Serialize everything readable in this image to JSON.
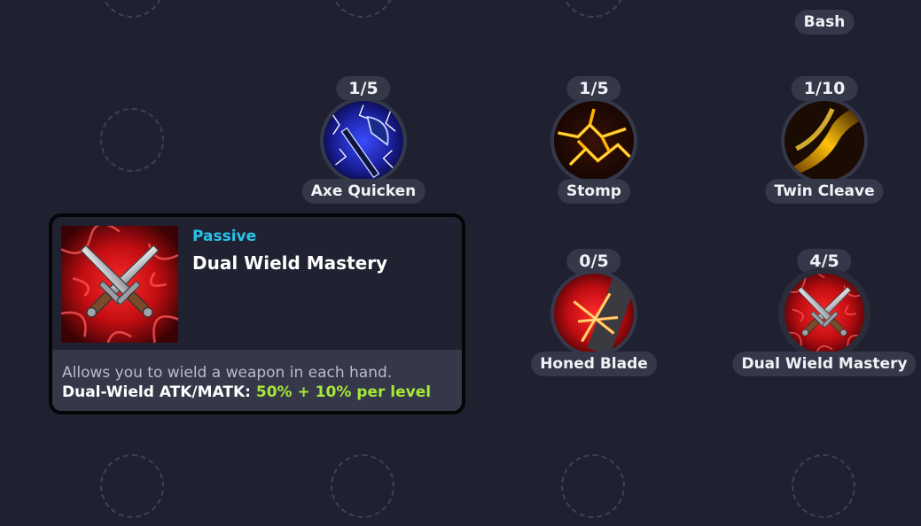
{
  "skill_tree": {
    "nodes": [
      {
        "id": "bash",
        "name": "Bash",
        "level": null,
        "icon": "bash-icon"
      },
      {
        "id": "axe_quicken",
        "name": "Axe Quicken",
        "level": "1/5",
        "icon": "axe-quicken-icon"
      },
      {
        "id": "stomp",
        "name": "Stomp",
        "level": "1/5",
        "icon": "stomp-icon"
      },
      {
        "id": "twin_cleave",
        "name": "Twin Cleave",
        "level": "1/10",
        "icon": "twin-cleave-icon"
      },
      {
        "id": "honed_blade",
        "name": "Honed Blade",
        "level": "0/5",
        "icon": "honed-blade-icon"
      },
      {
        "id": "dual_wield_mastery",
        "name": "Dual Wield Mastery",
        "level": "4/5",
        "icon": "dual-wield-mastery-icon"
      }
    ]
  },
  "tooltip": {
    "type": "Passive",
    "title": "Dual Wield Mastery",
    "description": "Allows you to wield a weapon in each hand.",
    "stat_label": "Dual-Wield ATK/MATK:",
    "stat_value": "50% + 10% per level",
    "icon": "crossed-daggers-icon"
  },
  "colors": {
    "background": "#1f2130",
    "pill": "#353849",
    "passive_accent": "#29c4ec",
    "stat_value": "#a7e83a"
  }
}
